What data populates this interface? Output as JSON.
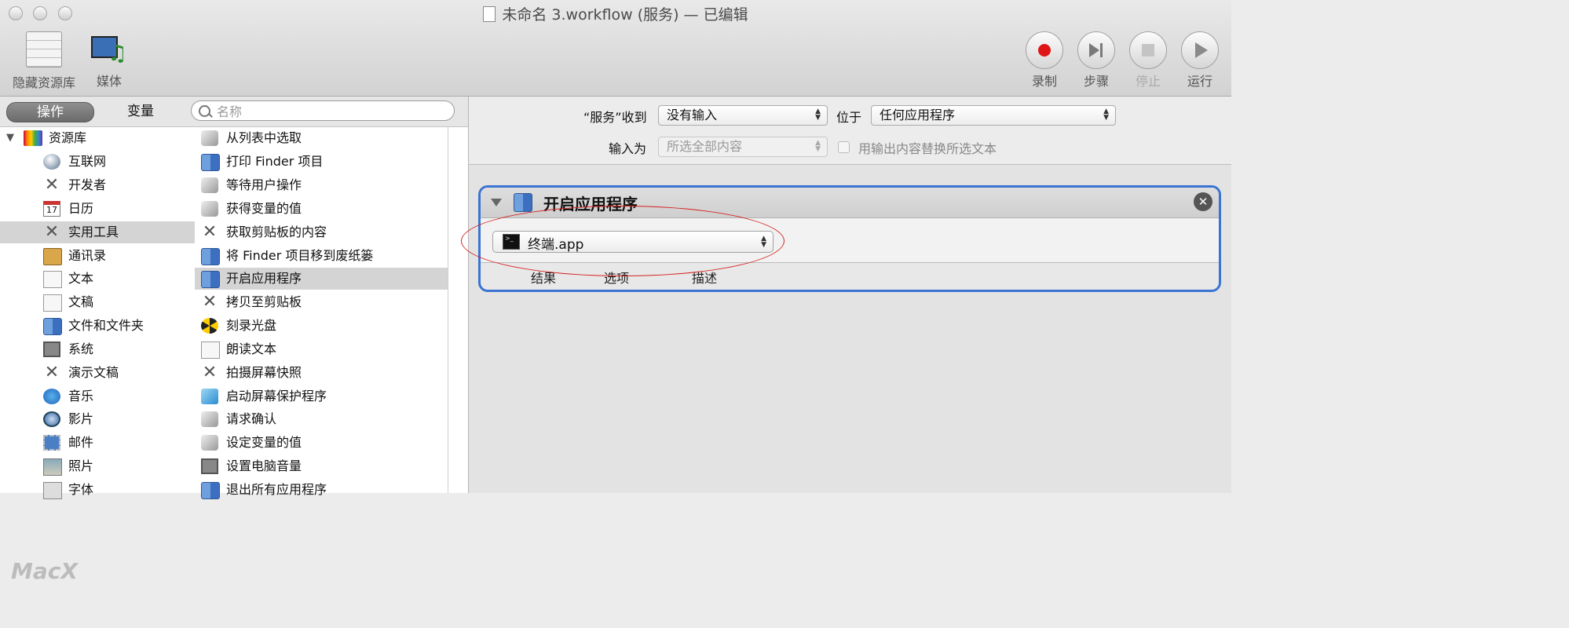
{
  "window": {
    "title": "未命名 3.workflow (服务) — 已编辑"
  },
  "toolbar": {
    "hide_library_label": "隐藏资源库",
    "media_label": "媒体",
    "record_label": "录制",
    "step_label": "步骤",
    "stop_label": "停止",
    "run_label": "运行"
  },
  "library": {
    "actions_tab": "操作",
    "variables_tab": "变量",
    "search_placeholder": "名称",
    "categories": [
      {
        "label": "资源库",
        "icon": "library-icon"
      },
      {
        "label": "互联网",
        "icon": "globe-icon"
      },
      {
        "label": "开发者",
        "icon": "tools-icon"
      },
      {
        "label": "日历",
        "icon": "calendar-icon"
      },
      {
        "label": "实用工具",
        "icon": "tools-icon"
      },
      {
        "label": "通讯录",
        "icon": "contacts-icon"
      },
      {
        "label": "文本",
        "icon": "text-icon"
      },
      {
        "label": "文稿",
        "icon": "document-icon"
      },
      {
        "label": "文件和文件夹",
        "icon": "finder-icon"
      },
      {
        "label": "系统",
        "icon": "system-icon"
      },
      {
        "label": "演示文稿",
        "icon": "tools-icon"
      },
      {
        "label": "音乐",
        "icon": "music-icon"
      },
      {
        "label": "影片",
        "icon": "quicktime-icon"
      },
      {
        "label": "邮件",
        "icon": "mail-icon"
      },
      {
        "label": "照片",
        "icon": "photo-icon"
      },
      {
        "label": "字体",
        "icon": "font-icon"
      }
    ],
    "calendar_day": "17",
    "actions": [
      {
        "label": "从列表中选取",
        "icon": "automator-icon"
      },
      {
        "label": "打印 Finder 项目",
        "icon": "finder-icon"
      },
      {
        "label": "等待用户操作",
        "icon": "automator-icon"
      },
      {
        "label": "获得变量的值",
        "icon": "automator-icon"
      },
      {
        "label": "获取剪贴板的内容",
        "icon": "tools-icon"
      },
      {
        "label": "将 Finder 项目移到废纸篓",
        "icon": "finder-icon"
      },
      {
        "label": "开启应用程序",
        "icon": "finder-icon"
      },
      {
        "label": "拷贝至剪贴板",
        "icon": "tools-icon"
      },
      {
        "label": "刻录光盘",
        "icon": "burn-icon"
      },
      {
        "label": "朗读文本",
        "icon": "text-icon"
      },
      {
        "label": "拍摄屏幕快照",
        "icon": "tools-icon"
      },
      {
        "label": "启动屏幕保护程序",
        "icon": "screensaver-icon"
      },
      {
        "label": "请求确认",
        "icon": "automator-icon"
      },
      {
        "label": "设定变量的值",
        "icon": "automator-icon"
      },
      {
        "label": "设置电脑音量",
        "icon": "system-icon"
      },
      {
        "label": "退出所有应用程序",
        "icon": "finder-icon"
      }
    ]
  },
  "service_config": {
    "receives_label": "“服务”收到",
    "input_type": "没有输入",
    "in_label": "位于",
    "application": "任何应用程序",
    "input_is_label": "输入为",
    "input_is_value": "所选全部内容",
    "replace_label": "用输出内容替换所选文本"
  },
  "action_card": {
    "title": "开启应用程序",
    "app_value": "终端.app",
    "tabs": [
      "结果",
      "选项",
      "描述"
    ]
  },
  "watermark": "MacX",
  "colors": {
    "selection_blue": "#3b74d2",
    "annotation_red": "#d42020",
    "record_red": "#e01515"
  }
}
